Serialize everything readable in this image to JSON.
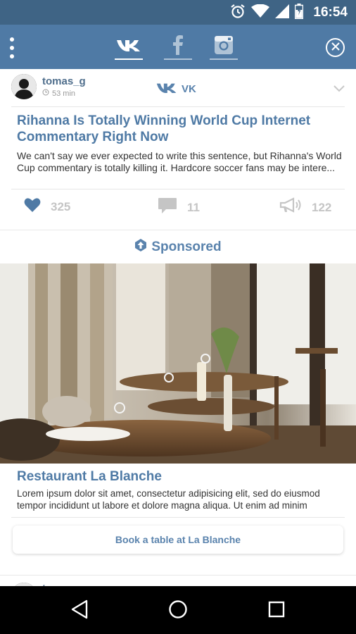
{
  "status_bar": {
    "time": "16:54",
    "icons": [
      "alarm-icon",
      "wifi-icon",
      "signal-icon",
      "battery-icon"
    ]
  },
  "app_bar": {
    "tabs": [
      {
        "name": "vk",
        "icon": "vk-logo-icon",
        "active": true
      },
      {
        "name": "facebook",
        "icon": "facebook-logo-icon",
        "active": false
      },
      {
        "name": "instagram",
        "icon": "instagram-logo-icon",
        "active": false
      }
    ],
    "accent": "#4f7aa5"
  },
  "post": {
    "username": "tomas_g",
    "time_ago": "53 min",
    "source": "VK",
    "title": "Rihanna Is Totally Winning World Cup Internet Commentary Right Now",
    "body": "We can't say we ever expected to write this sentence, but Rihanna's World Cup commentary is totally killing it. Hardcore soccer fans may be intere...",
    "likes": "325",
    "comments": "11",
    "shares": "122"
  },
  "sponsored": {
    "label": "Sponsored"
  },
  "ad": {
    "title": "Restaurant La Blanche",
    "body": "Lorem ipsum dolor sit amet, consectetur adipisicing elit, sed do eiusmod tempor incididunt ut labore et dolore magna aliqua. Ut enim ad minim",
    "button_label": "Book a table at La Blanche"
  },
  "next_post": {
    "username": "tomas_g"
  }
}
